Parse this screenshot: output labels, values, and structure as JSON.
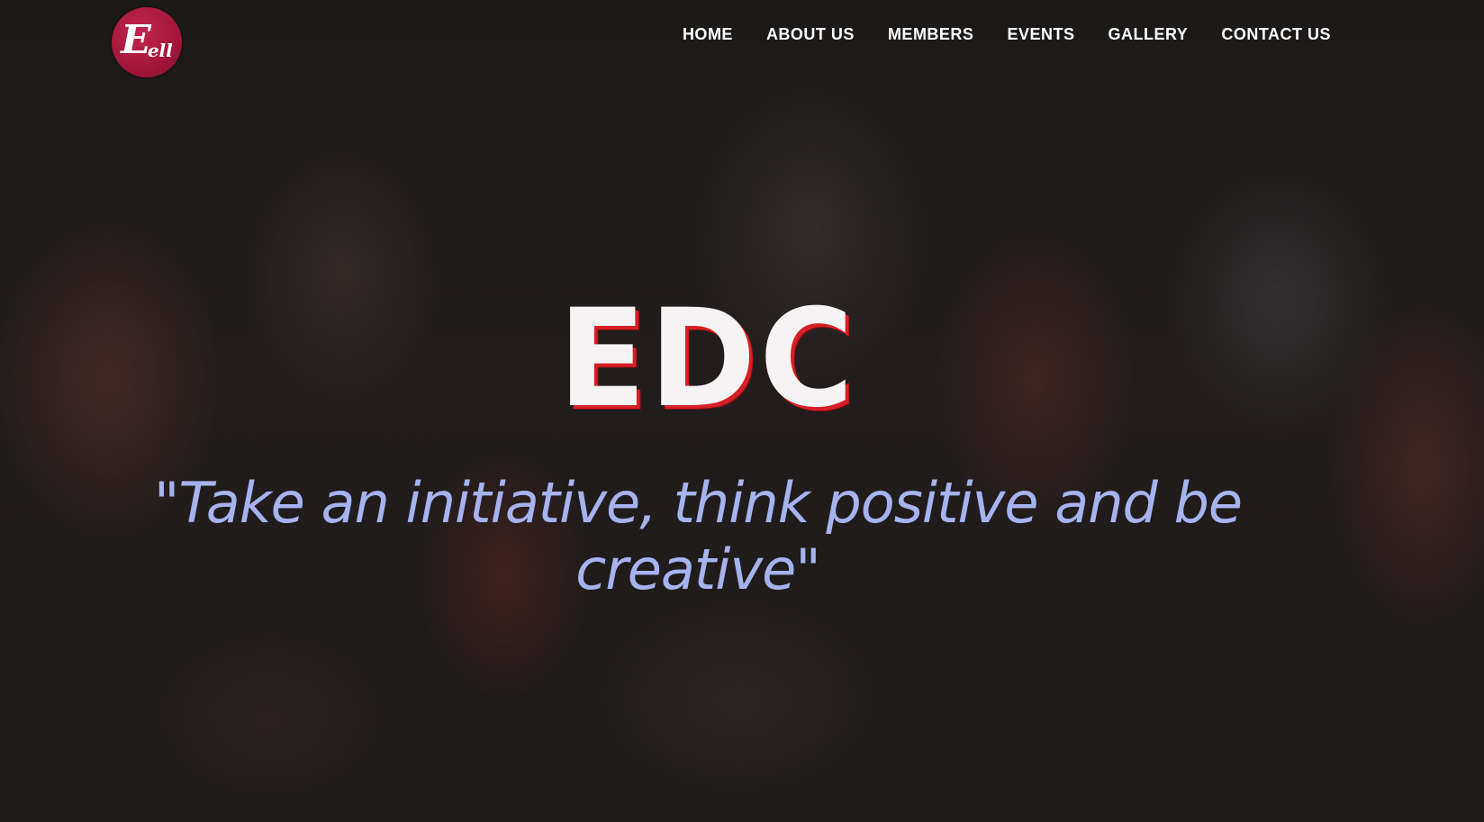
{
  "brand": {
    "logo_letter": "E",
    "logo_suffix": "ell"
  },
  "nav": {
    "items": [
      {
        "label": "HOME"
      },
      {
        "label": "ABOUT US"
      },
      {
        "label": "MEMBERS"
      },
      {
        "label": "EVENTS"
      },
      {
        "label": "GALLERY"
      },
      {
        "label": "CONTACT US"
      }
    ]
  },
  "hero": {
    "title": "EDC",
    "quote": "\"Take an initiative, think positive and be creative\""
  },
  "colors": {
    "logo_bg": "#a3163a",
    "title_shadow": "#d61f26",
    "quote_text": "#a6b3ef",
    "nav_text": "#ffffff"
  }
}
